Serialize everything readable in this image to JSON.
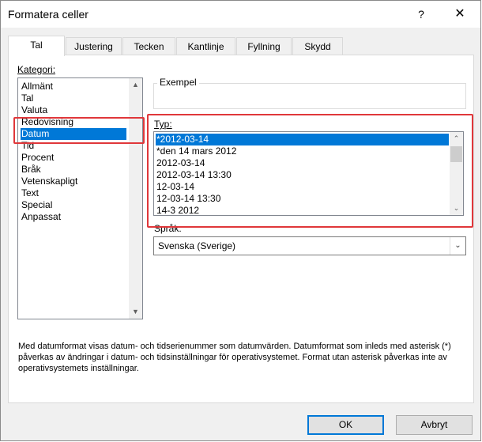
{
  "window": {
    "title": "Formatera celler",
    "help_glyph": "?",
    "close_glyph": "✕"
  },
  "tabs": [
    {
      "label": "Tal",
      "active": true
    },
    {
      "label": "Justering"
    },
    {
      "label": "Tecken"
    },
    {
      "label": "Kantlinje"
    },
    {
      "label": "Fyllning"
    },
    {
      "label": "Skydd"
    }
  ],
  "category": {
    "label": "Kategori:",
    "items": [
      "Allmänt",
      "Tal",
      "Valuta",
      "Redovisning",
      "Datum",
      "Tid",
      "Procent",
      "Bråk",
      "Vetenskapligt",
      "Text",
      "Special",
      "Anpassat"
    ],
    "selected": "Datum"
  },
  "example": {
    "label": "Exempel",
    "value": ""
  },
  "type": {
    "label": "Typ:",
    "items": [
      "*2012-03-14",
      "*den 14 mars 2012",
      "2012-03-14",
      "2012-03-14 13:30",
      "12-03-14",
      "12-03-14 13:30",
      "14-3 2012"
    ],
    "selected": "*2012-03-14"
  },
  "language": {
    "label": "Språk:",
    "value": "Svenska (Sverige)"
  },
  "description": "Med datumformat visas datum- och tidserienummer som datumvärden. Datumformat som inleds med asterisk (*) påverkas av ändringar i datum- och tidsinställningar för operativsystemet. Format utan asterisk påverkas inte av operativsystemets inställningar.",
  "buttons": {
    "ok": "OK",
    "cancel": "Avbryt"
  },
  "colors": {
    "selection": "#0078d7",
    "highlight": "#e0373a"
  }
}
